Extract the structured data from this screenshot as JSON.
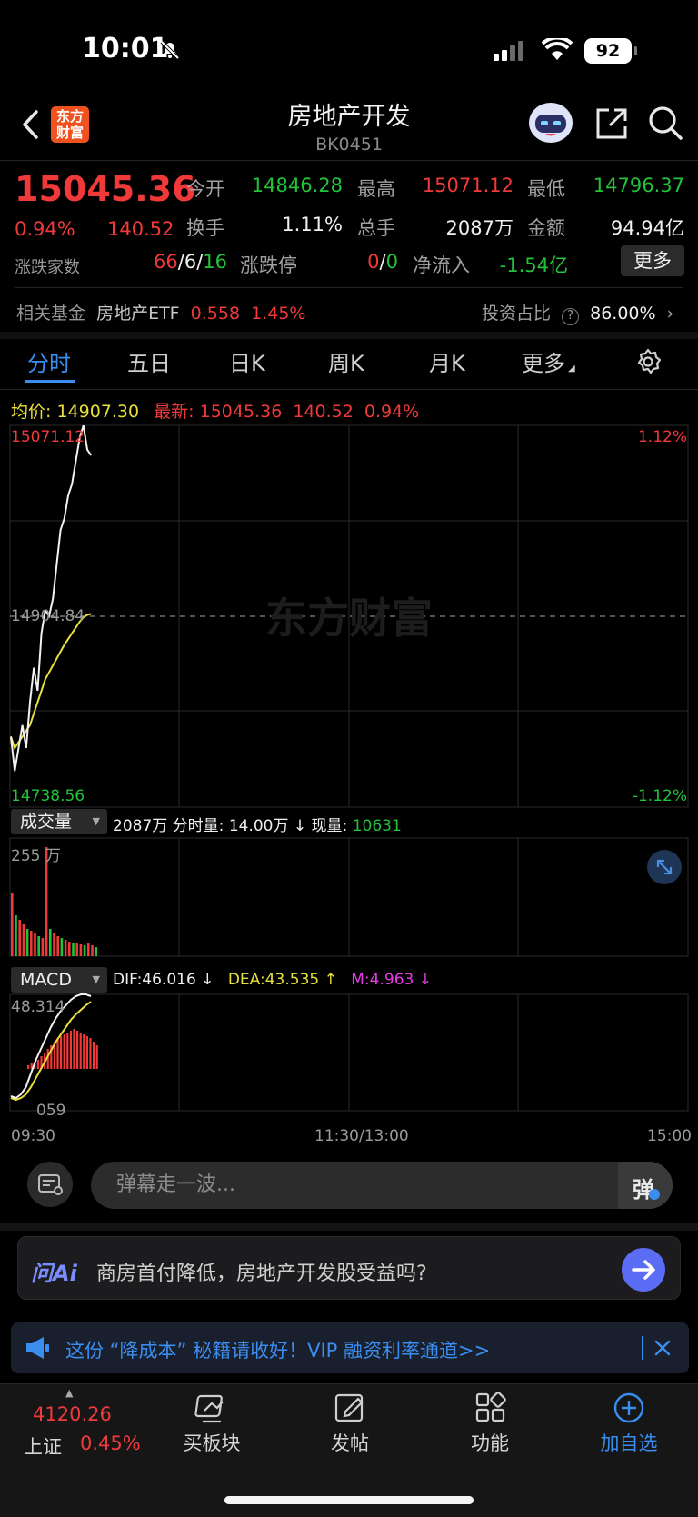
{
  "status": {
    "time": "10:01",
    "battery": "92"
  },
  "header": {
    "title": "房地产开发",
    "code": "BK0451",
    "logo_text": "东方财富"
  },
  "quote": {
    "price": "15045.36",
    "change_pct": "0.94%",
    "change": "140.52",
    "open_label": "今开",
    "open": "14846.28",
    "high_label": "最高",
    "high": "15071.12",
    "low_label": "最低",
    "low": "14796.37",
    "turnover_label": "换手",
    "turnover": "1.11%",
    "volume_label": "总手",
    "volume": "2087万",
    "amount_label": "金额",
    "amount": "94.94亿",
    "updown_label": "涨跌家数",
    "up_count": "66",
    "flat_count": "6",
    "down_count": "16",
    "limit_label": "涨跌停",
    "limit_up": "0",
    "limit_down": "0",
    "netflow_label": "净流入",
    "netflow": "-1.54亿",
    "more_button": "更多",
    "fund_label": "相关基金",
    "fund_name": "房地产ETF",
    "fund_price": "0.558",
    "fund_pct": "1.45%",
    "invest_label": "投资占比",
    "invest_pct": "86.00%"
  },
  "tabs": [
    "分时",
    "五日",
    "日K",
    "周K",
    "月K",
    "更多"
  ],
  "intraday": {
    "avg_label": "均价:",
    "avg_value": "14907.30",
    "latest_label": "最新:",
    "latest_price": "15045.36",
    "latest_change": "140.52",
    "latest_pct": "0.94%",
    "y_top": "15071.12",
    "y_mid": "14904.84",
    "y_bottom": "14738.56",
    "pct_top": "1.12%",
    "pct_bottom": "-1.12%",
    "watermark": "东方财富",
    "time_start": "09:30",
    "time_mid": "11:30/13:00",
    "time_end": "15:00"
  },
  "volume_panel": {
    "selector": "成交量",
    "total": "2087万",
    "tick_label": "分时量:",
    "tick_value": "14.00万",
    "tick_arrow": "↓",
    "now_label": "现量:",
    "now_value": "10631",
    "y_max": "255 万"
  },
  "macd_panel": {
    "selector": "MACD",
    "dif": "DIF:46.016 ↓",
    "dea": "DEA:43.535 ↑",
    "m": "M:4.963 ↓",
    "y_max": "48.314",
    "y_min": "059"
  },
  "danmu": {
    "placeholder": "弹幕走一波...",
    "button_glyph": "弹"
  },
  "ai": {
    "brand": "问Ai",
    "question": "商房首付降低，房地产开发股受益吗?"
  },
  "promo": {
    "text": "这份 “降成本” 秘籍请收好！VIP 融资利率通道>>"
  },
  "bottom_nav": {
    "index_value": "4120.26",
    "index_name": "上证",
    "index_pct": "0.45%",
    "items": [
      "买板块",
      "发帖",
      "功能",
      "加自选"
    ]
  },
  "chart_data": {
    "type": "line",
    "title": "",
    "xlabel": "",
    "ylabel": "",
    "ylim": [
      14738.56,
      15071.12
    ],
    "x_ticks": [
      "09:30",
      "11:30/13:00",
      "15:00"
    ],
    "series": [
      {
        "name": "最新",
        "values": [
          14800,
          14770,
          14790,
          14810,
          14790,
          14830,
          14860,
          14840,
          14890,
          14910,
          14905,
          14920,
          14950,
          14980,
          14990,
          15010,
          15020,
          15040,
          15060,
          15071,
          15050,
          15045
        ]
      },
      {
        "name": "均价",
        "values": [
          14800,
          14790,
          14795,
          14800,
          14805,
          14810,
          14820,
          14830,
          14840,
          14850,
          14856,
          14862,
          14868,
          14874,
          14880,
          14885,
          14890,
          14895,
          14900,
          14904,
          14906,
          14907
        ]
      }
    ]
  }
}
